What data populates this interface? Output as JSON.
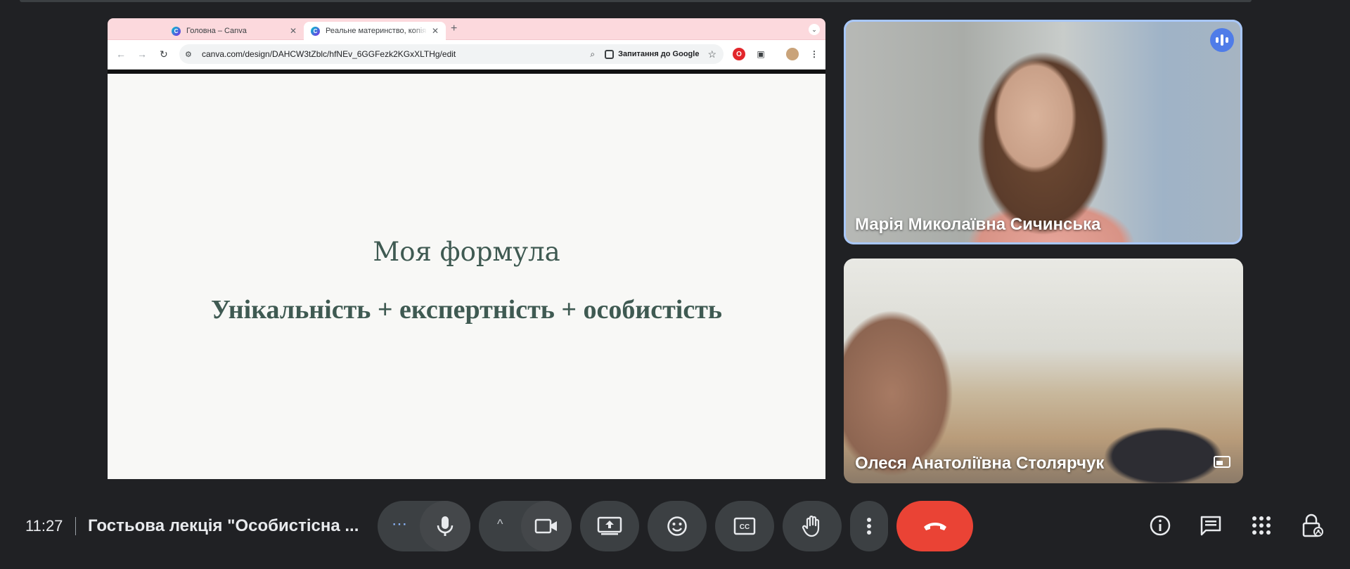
{
  "browser": {
    "tabs": [
      {
        "label": "Головна – Canva",
        "active": false
      },
      {
        "label": "Реальне материнство, копія",
        "active": true
      }
    ],
    "url": "canva.com/design/DAHCW3tZblc/hfNEv_6GGFezk2KGxXLTHg/edit",
    "ask_google": "Запитання до Google",
    "icons": [
      "back-icon",
      "forward-icon",
      "reload-icon",
      "site-info-icon",
      "zoom-icon",
      "google-lens-icon",
      "star-icon",
      "opera-extension-icon",
      "puzzle-extension-icon",
      "profile-avatar-icon",
      "kebab-menu-icon"
    ]
  },
  "slide": {
    "title": "Моя формула",
    "formula": "Унікальність + експертність + особистість",
    "text_color": "#3f5a52"
  },
  "participants": [
    {
      "name": "Марія Миколаївна Сичинська",
      "speaking": true,
      "highlight": "#a8c7fa"
    },
    {
      "name": "Олеся Анатоліївна Столярчук",
      "speaking": false
    }
  ],
  "bottom_bar": {
    "time": "11:27",
    "meeting_title": "Гостьова лекція \"Особистісна ...",
    "hangup_color": "#ea4335",
    "controls": [
      "more-options",
      "microphone",
      "camera-options",
      "camera",
      "present-screen",
      "reactions",
      "captions",
      "raise-hand",
      "more-actions",
      "leave-call"
    ],
    "right_icons": [
      "meeting-info",
      "chat",
      "activities",
      "host-controls"
    ]
  }
}
